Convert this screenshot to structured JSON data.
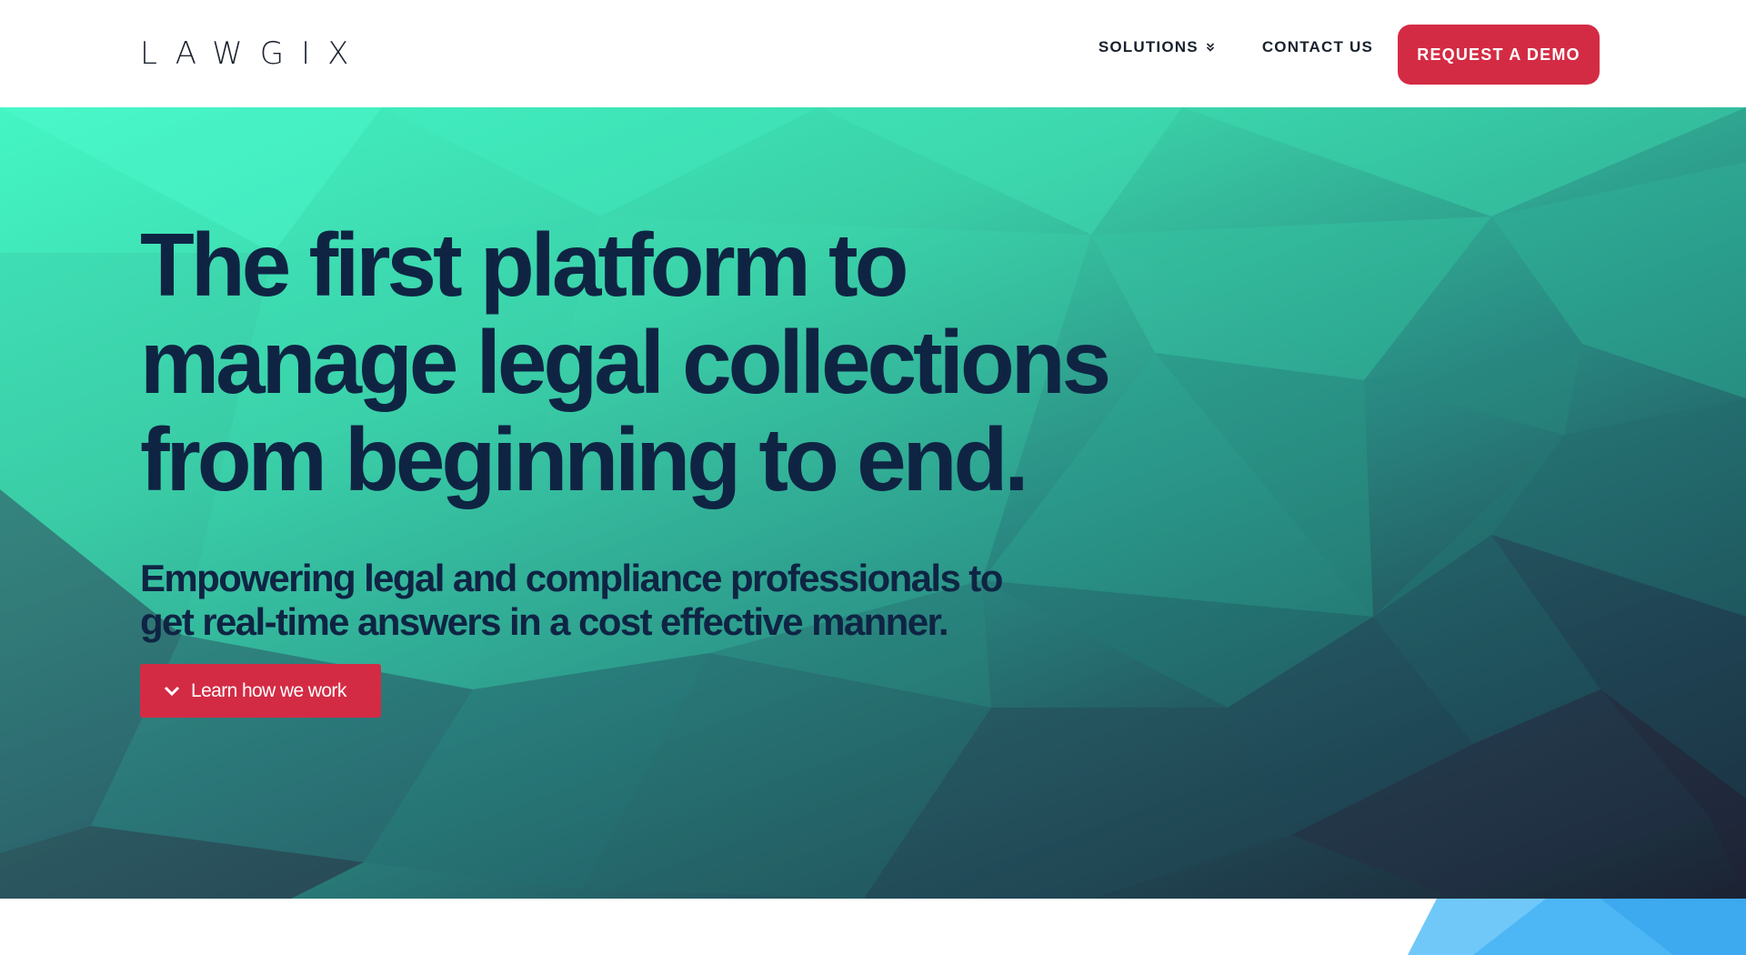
{
  "header": {
    "logo_text": "LAWGIX",
    "nav": {
      "solutions_label": "SOLUTIONS",
      "contact_label": "CONTACT US",
      "demo_label": "REQUEST A DEMO"
    }
  },
  "hero": {
    "headline": "The first platform to manage legal collections from beginning to end.",
    "subheadline": "Empowering legal and compliance professionals to get real-time answers in a cost effective manner.",
    "cta_label": "Learn how we work"
  },
  "colors": {
    "accent": "#d42b44",
    "headline_text": "#0f2443",
    "hero_teal": "#2bd4a6",
    "hero_dark": "#20283b"
  },
  "icons": {
    "solutions_dropdown": "double-chevron-down-icon",
    "cta": "chevron-down-icon"
  }
}
